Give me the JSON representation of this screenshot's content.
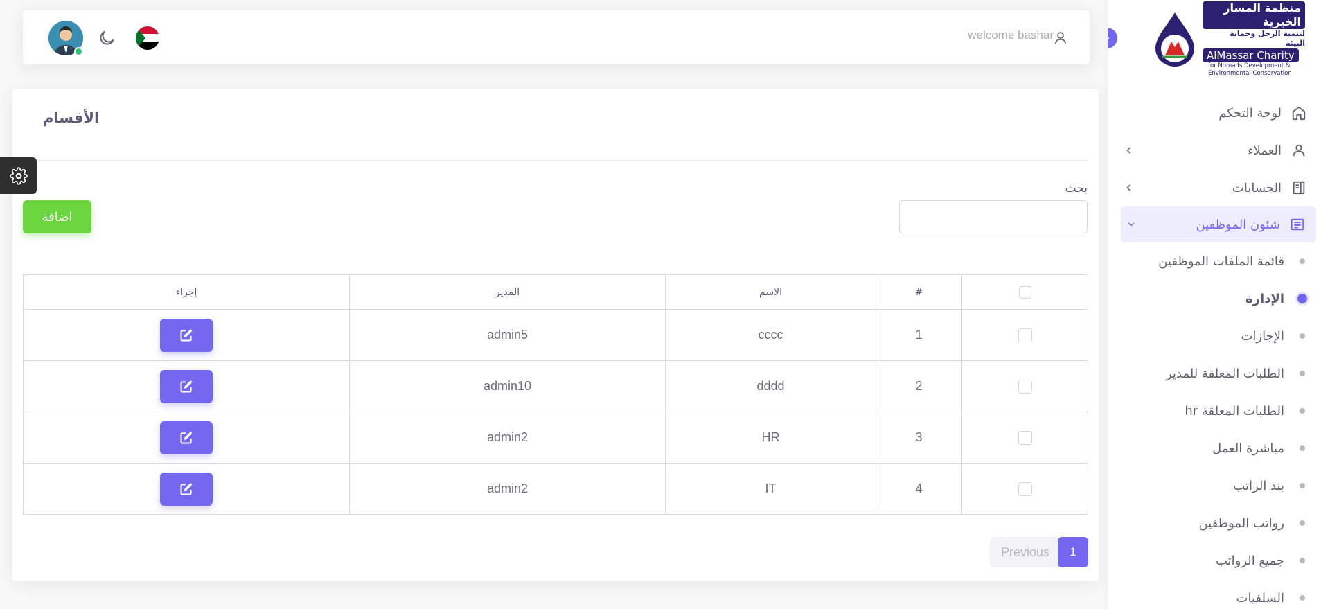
{
  "brand": {
    "name_ar_line1": "منظمة المسار الخيرية",
    "name_ar_line2": "لتنمية الرحل وحماية البيئة",
    "name_en": "AlMassar Charity",
    "tagline_line1": "for Nomads Development &",
    "tagline_line2": "Environmental Conservation"
  },
  "topbar": {
    "welcome_text": "welcome bashar",
    "user_icon": "user-icon",
    "theme_icon": "moon-icon",
    "flag_icon": "sudan-flag-icon"
  },
  "sidebar": {
    "items": [
      {
        "label": "لوحة التحكم",
        "icon": "home-icon"
      },
      {
        "label": "العملاء",
        "icon": "user-icon"
      },
      {
        "label": "الحسابات",
        "icon": "book-icon"
      },
      {
        "label": "شئون الموظفين",
        "icon": "file-text-icon"
      }
    ],
    "subitems": [
      {
        "label": "قائمة الملفات الموظفين"
      },
      {
        "label": "الإدارة"
      },
      {
        "label": "الإجازات"
      },
      {
        "label": "الطلبات المعلقة للمدير"
      },
      {
        "label": "الطلبات المعلقة hr"
      },
      {
        "label": "مباشرة العمل"
      },
      {
        "label": "بند الراتب"
      },
      {
        "label": "رواتب الموظفين"
      },
      {
        "label": "جميع الرواتب"
      },
      {
        "label": "السلفيات"
      }
    ]
  },
  "page": {
    "title": "الأقسام",
    "search_label": "بحث",
    "search_value": "",
    "add_button": "اضافة"
  },
  "table": {
    "headers": {
      "index": "#",
      "name": "الاسم",
      "manager": "المدير",
      "action": "إجراء"
    },
    "rows": [
      {
        "index": "1",
        "name": "cccc",
        "manager": "admin5"
      },
      {
        "index": "2",
        "name": "dddd",
        "manager": "admin10"
      },
      {
        "index": "3",
        "name": "HR",
        "manager": "admin2"
      },
      {
        "index": "4",
        "name": "IT",
        "manager": "admin2"
      }
    ]
  },
  "pagination": {
    "previous": "Previous",
    "current": "1"
  },
  "colors": {
    "primary": "#7367f0",
    "success": "#6bd63f",
    "brand_navy": "#2b2170"
  }
}
